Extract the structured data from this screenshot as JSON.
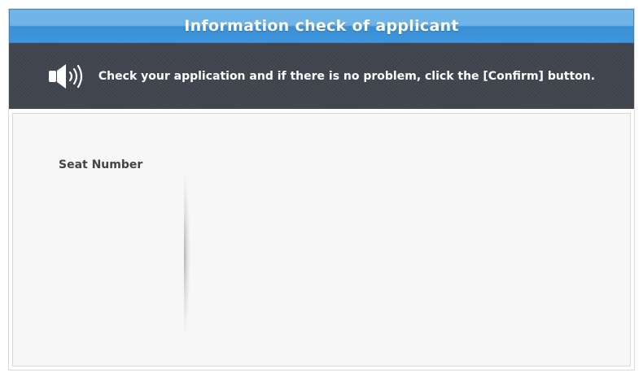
{
  "window": {
    "title": "Information check of applicant"
  },
  "notice": {
    "icon": "speaker-icon",
    "text": "Check your application and if there is no problem, click the [Confirm] button."
  },
  "form": {
    "seat_number_label": "Seat Number",
    "seat_number_value": ""
  },
  "colors": {
    "titlebar_top": "#72b6e8",
    "titlebar_bottom": "#3f95da",
    "notice_bg": "#41454f",
    "content_bg": "#f7f7f7",
    "label_text": "#444444"
  }
}
